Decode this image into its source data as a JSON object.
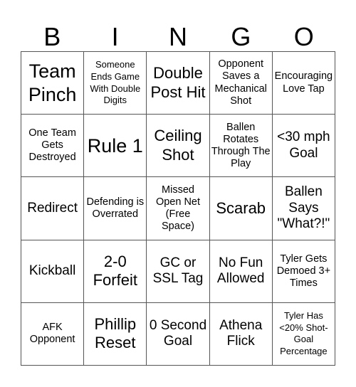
{
  "header": [
    "B",
    "I",
    "N",
    "G",
    "O"
  ],
  "cells": [
    {
      "text": "Team Pinch",
      "size": "xl"
    },
    {
      "text": "Someone Ends Game With Double Digits",
      "size": "xs"
    },
    {
      "text": "Double Post Hit",
      "size": "l"
    },
    {
      "text": "Opponent Saves a Mechanical Shot",
      "size": "s"
    },
    {
      "text": "Encouraging Love Tap",
      "size": "s"
    },
    {
      "text": "One Team Gets Destroyed",
      "size": "s"
    },
    {
      "text": "Rule 1",
      "size": "xl"
    },
    {
      "text": "Ceiling Shot",
      "size": "l"
    },
    {
      "text": "Ballen Rotates Through The Play",
      "size": "s"
    },
    {
      "text": "<30 mph Goal",
      "size": "ml"
    },
    {
      "text": "Redirect",
      "size": "ml"
    },
    {
      "text": "Defending is Overrated",
      "size": "s"
    },
    {
      "text": "Missed Open Net (Free Space)",
      "size": "s"
    },
    {
      "text": "Scarab",
      "size": "l"
    },
    {
      "text": "Ballen Says \"What?!\"",
      "size": "ml"
    },
    {
      "text": "Kickball",
      "size": "ml"
    },
    {
      "text": "2-0 Forfeit",
      "size": "l"
    },
    {
      "text": "GC or SSL Tag",
      "size": "ml"
    },
    {
      "text": "No Fun Allowed",
      "size": "ml"
    },
    {
      "text": "Tyler Gets Demoed 3+ Times",
      "size": "s"
    },
    {
      "text": "AFK Opponent",
      "size": "s"
    },
    {
      "text": "Phillip Reset",
      "size": "l"
    },
    {
      "text": "0 Second Goal",
      "size": "ml"
    },
    {
      "text": "Athena Flick",
      "size": "ml"
    },
    {
      "text": "Tyler Has <20% Shot-Goal Percentage",
      "size": "xs"
    }
  ]
}
